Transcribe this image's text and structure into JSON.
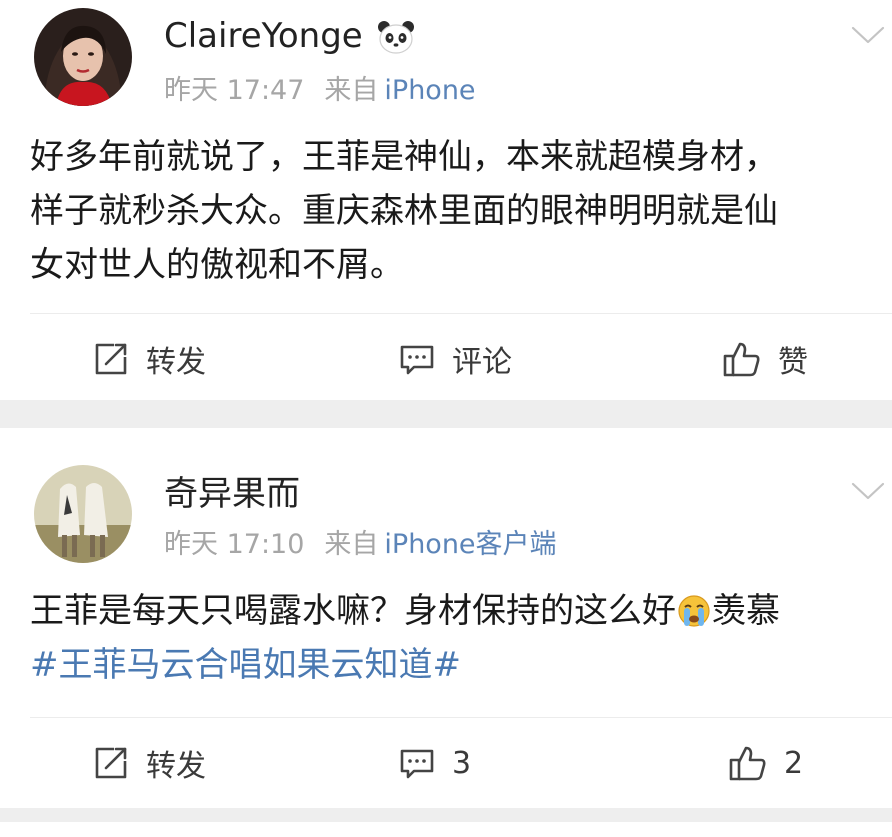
{
  "posts": [
    {
      "username": "ClaireYonge",
      "badge_icon": "panda-icon",
      "time": "昨天 17:47",
      "from_label": "来自",
      "source": "iPhone",
      "text_lines": [
        "好多年前就说了，王菲是神仙，本来就超模身材，",
        "样子就秒杀大众。重庆森林里面的眼神明明就是仙",
        "女对世人的傲视和不屑。"
      ],
      "actions": {
        "repost": "转发",
        "comment": "评论",
        "like": "赞"
      }
    },
    {
      "username": "奇异果而",
      "time": "昨天 17:10",
      "from_label": "来自",
      "source": "iPhone客户端",
      "text_before_emoji": "王菲是每天只喝露水嘛？身材保持的这么好",
      "emoji": "crying-face-emoji",
      "text_after_emoji": "羡慕",
      "hashtag": "#王菲马云合唱如果云知道#",
      "actions": {
        "repost": "转发",
        "comment": "3",
        "like": "2"
      }
    }
  ],
  "colors": {
    "link_blue": "#4a79b2",
    "meta_gray": "#a6a6a6",
    "feed_background": "#eeeeee"
  }
}
